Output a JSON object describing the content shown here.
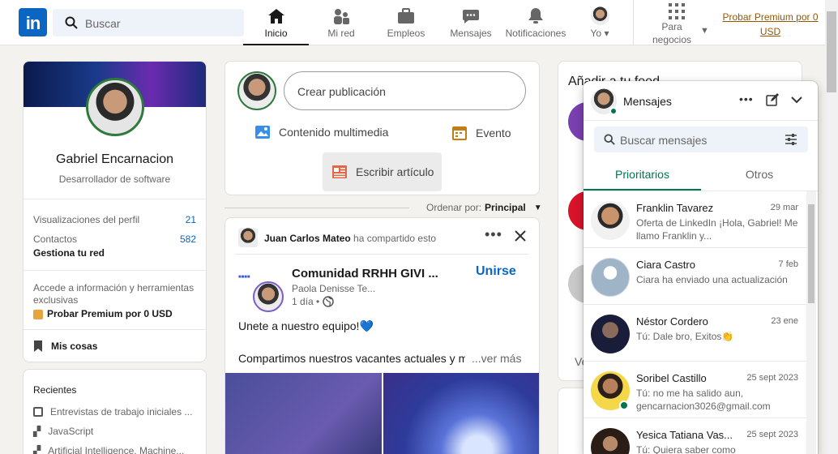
{
  "nav": {
    "logo": "in",
    "search_placeholder": "Buscar",
    "items": [
      {
        "label": "Inicio"
      },
      {
        "label": "Mi red"
      },
      {
        "label": "Empleos"
      },
      {
        "label": "Mensajes"
      },
      {
        "label": "Notificaciones"
      },
      {
        "label": "Yo"
      }
    ],
    "business_label_1": "Para",
    "business_label_2": "negocios",
    "premium_line1": "Probar Premium por 0",
    "premium_line2": "USD"
  },
  "profile": {
    "name": "Gabriel Encarnacion",
    "headline": "Desarrollador de software",
    "stat1_label": "Visualizaciones del perfil",
    "stat1_value": "21",
    "stat2_label": "Contactos",
    "stat2_value": "582",
    "stat2_sub": "Gestiona tu red",
    "premium_text": "Accede a información y herramientas exclusivas",
    "premium_link": "Probar Premium por 0 USD",
    "my_items": "Mis cosas"
  },
  "recent": {
    "title": "Recientes",
    "items": [
      "Entrevistas de trabajo iniciales ...",
      "JavaScript",
      "Artificial Intelligence, Machine..."
    ]
  },
  "share": {
    "create_post": "Crear publicación",
    "media": "Contenido multimedia",
    "event": "Evento",
    "article": "Escribir artículo"
  },
  "sort": {
    "label": "Ordenar por:",
    "value": "Principal"
  },
  "post": {
    "sharer": "Juan Carlos Mateo",
    "shared_text": "ha compartido esto",
    "group_name": "Comunidad RRHH GIVI ...",
    "join": "Unirse",
    "author": "Paola Denisse Te...",
    "time": "1 día •",
    "line1": "Unete a nuestro equipo!💙",
    "line2": "Compartimos nuestros vacantes actuales y m",
    "more": "...ver más"
  },
  "feed_right": {
    "title": "Añadir a tu feed",
    "partial": "Ve"
  },
  "messaging": {
    "title": "Mensajes",
    "search_placeholder": "Buscar mensajes",
    "tab_focused": "Prioritarios",
    "tab_other": "Otros",
    "conversations": [
      {
        "name": "Franklin Tavarez",
        "date": "29 mar",
        "preview": "Oferta de LinkedIn ¡Hola, Gabriel! Me llamo Franklin y..."
      },
      {
        "name": "Ciara Castro",
        "date": "7 feb",
        "preview": "Ciara ha enviado una actualización"
      },
      {
        "name": "Néstor Cordero",
        "date": "23 ene",
        "preview": "Tú: Dale bro, Exitos👏"
      },
      {
        "name": "Soribel Castillo",
        "date": "25 sept 2023",
        "preview": "Tú: no me ha salido aun, gencarnacion3026@gmail.com"
      },
      {
        "name": "Yesica Tatiana Vas...",
        "date": "25 sept 2023",
        "preview": "Tú: Quiera saber como"
      }
    ]
  }
}
